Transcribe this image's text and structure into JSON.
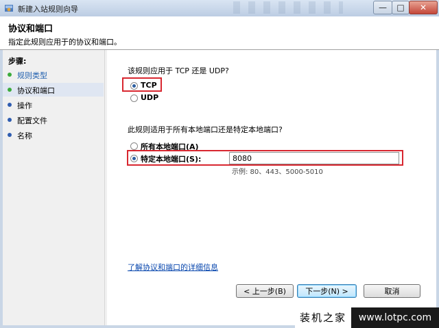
{
  "window": {
    "title": "新建入站规则向导"
  },
  "header": {
    "title": "协议和端口",
    "description": "指定此规则应用于的协议和端口。"
  },
  "sidebar": {
    "title": "步骤:",
    "steps": [
      {
        "label": "规则类型",
        "bullet": "#3cab3c",
        "color": "#1f5fae"
      },
      {
        "label": "协议和端口",
        "bullet": "#3cab3c",
        "color": "#000000"
      },
      {
        "label": "操作",
        "bullet": "#2f5db0",
        "color": "#000000"
      },
      {
        "label": "配置文件",
        "bullet": "#2f5db0",
        "color": "#000000"
      },
      {
        "label": "名称",
        "bullet": "#2f5db0",
        "color": "#000000"
      }
    ]
  },
  "protocol": {
    "question": "该规则应用于 TCP 还是 UDP?",
    "tcp_label": "TCP",
    "udp_label": "UDP",
    "selected": "TCP"
  },
  "ports": {
    "question": "此规则适用于所有本地端口还是特定本地端口?",
    "all_label": "所有本地端口(A)",
    "specific_label": "特定本地端口(S):",
    "selected": "specific",
    "value": "8080",
    "example": "示例: 80、443、5000-5010"
  },
  "learn_more": "了解协议和端口的详细信息",
  "buttons": {
    "back": "< 上一步(B)",
    "next": "下一步(N) >",
    "cancel": "取消"
  },
  "watermark": {
    "left": "装机之家",
    "right": "www.lotpc.com"
  },
  "colors": {
    "highlight": "#d8262f",
    "link": "#0645ad"
  }
}
